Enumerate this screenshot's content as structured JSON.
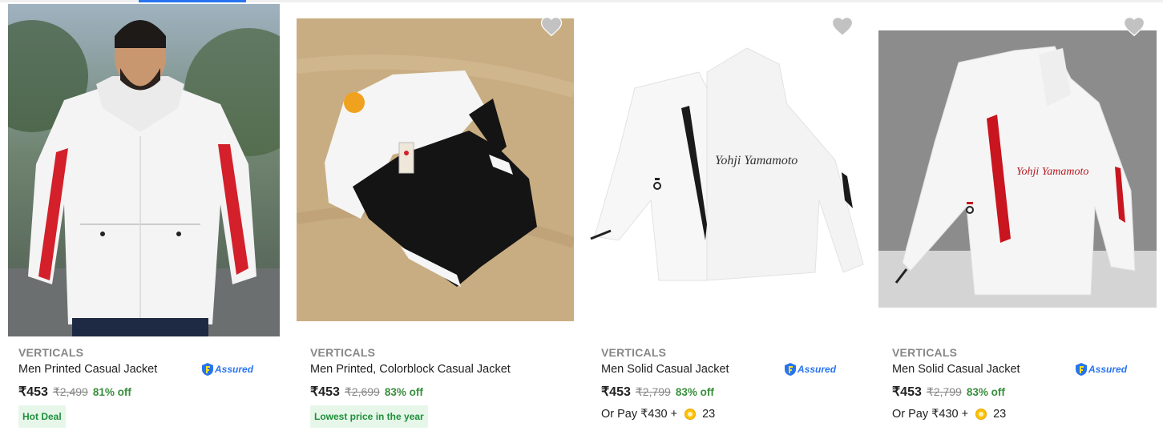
{
  "products": [
    {
      "brand": "VERTICALS",
      "title": "Men Printed Casual Jacket",
      "assured": "Assured",
      "price": "₹453",
      "mrp": "₹2,499",
      "discount": "81% off",
      "badge": "Hot Deal"
    },
    {
      "brand": "VERTICALS",
      "title": "Men Printed, Colorblock Casual Jacket",
      "price": "₹453",
      "mrp": "₹2,699",
      "discount": "83% off",
      "badge": "Lowest price in the year"
    },
    {
      "brand": "VERTICALS",
      "title": "Men Solid Casual Jacket",
      "assured": "Assured",
      "price": "₹453",
      "mrp": "₹2,799",
      "discount": "83% off",
      "or_pay": "Or Pay ₹430 +",
      "coins": "23"
    },
    {
      "brand": "VERTICALS",
      "title": "Men Solid Casual Jacket",
      "assured": "Assured",
      "price": "₹453",
      "mrp": "₹2,799",
      "discount": "83% off",
      "or_pay": "Or Pay ₹430 +",
      "coins": "23"
    }
  ],
  "colors": {
    "accent": "#2874f0",
    "discount_green": "#388e3c",
    "badge_bg": "#e6f7ea",
    "coin": "#ffc200"
  },
  "icons": {
    "wishlist": "heart-icon",
    "assured": "assured-shield-icon",
    "supercoin": "supercoin-icon"
  }
}
